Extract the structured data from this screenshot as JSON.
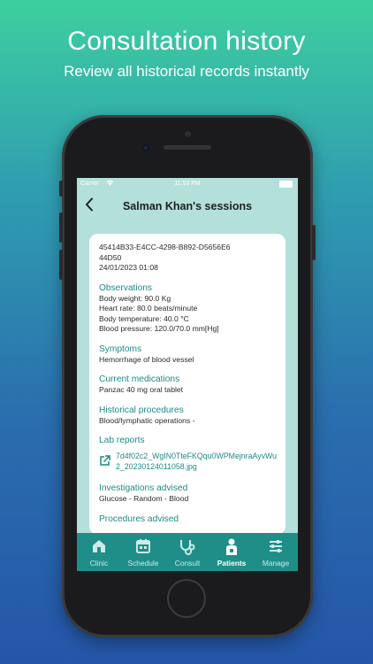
{
  "hero": {
    "title": "Consultation history",
    "subtitle": "Review all historical records instantly"
  },
  "status_bar": {
    "carrier": "Carrier",
    "time": "11:53 PM"
  },
  "nav": {
    "back_icon": "chevron-left-icon",
    "title": "Salman Khan's sessions"
  },
  "session": {
    "id": "45414B33-E4CC-4298-B892-D5656E644D50",
    "datetime": "24/01/2023 01:08",
    "observations": {
      "heading": "Observations",
      "items": [
        "Body weight: 90.0 Kg",
        "Heart rate: 80.0 beats/minute",
        "Body temperature: 40.0 °C",
        "Blood pressure: 120.0/70.0 mm[Hg]"
      ]
    },
    "symptoms": {
      "heading": "Symptoms",
      "value": "Hemorrhage of blood vessel"
    },
    "current_medications": {
      "heading": "Current medications",
      "value": "Panzac 40 mg oral tablet"
    },
    "historical_procedures": {
      "heading": "Historical procedures",
      "value": "Blood/lymphatic operations -"
    },
    "lab_reports": {
      "heading": "Lab reports",
      "icon": "external-link-icon",
      "file": "7d4f02c2_WgIN0TteFKQqu0WPMejnraAyvWu2_20230124011058.jpg"
    },
    "investigations_advised": {
      "heading": "Investigations advised",
      "value": "Glucose - Random - Blood"
    },
    "procedures_advised": {
      "heading": "Procedures advised"
    }
  },
  "tabs": [
    {
      "label": "Clinic",
      "icon": "clinic-icon",
      "active": false
    },
    {
      "label": "Schedule",
      "icon": "calendar-icon",
      "active": false
    },
    {
      "label": "Consult",
      "icon": "stethoscope-icon",
      "active": false
    },
    {
      "label": "Patients",
      "icon": "patient-icon",
      "active": true
    },
    {
      "label": "Manage",
      "icon": "sliders-icon",
      "active": false
    }
  ],
  "colors": {
    "accent": "#1f8a86",
    "tabbar": "#1f8e88",
    "screen_bg": "#b3e0da"
  }
}
